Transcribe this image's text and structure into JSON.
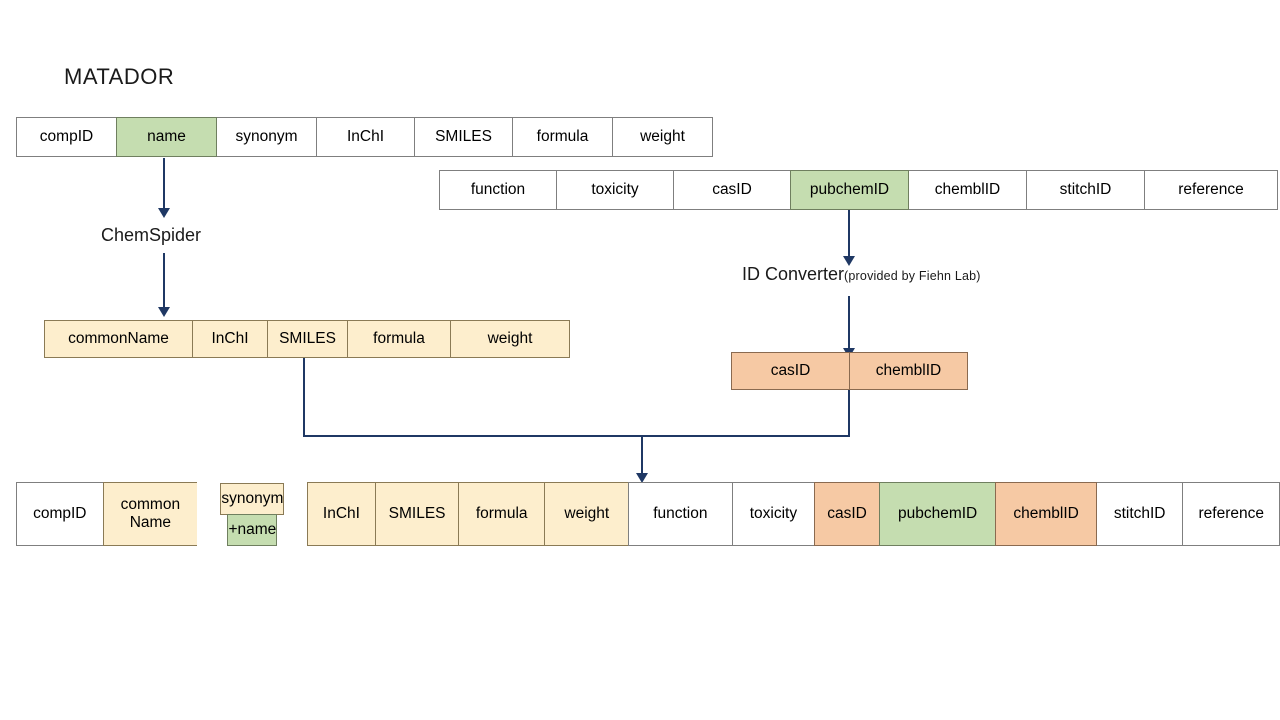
{
  "diagram": {
    "title": "MATADOR",
    "labels": {
      "chemspider": "ChemSpider",
      "id_converter": "ID Converter",
      "id_converter_note": "(provided by Fiehn Lab)"
    },
    "colors": {
      "green": "#c5ddb0",
      "tan": "#fdeecd",
      "orange": "#f6c9a4",
      "arrow": "#1f3864",
      "border": "#7f7f7f"
    },
    "matador_row_1": [
      {
        "label": "compID",
        "fill": "white"
      },
      {
        "label": "name",
        "fill": "green"
      },
      {
        "label": "synonym",
        "fill": "white"
      },
      {
        "label": "InChI",
        "fill": "white"
      },
      {
        "label": "SMILES",
        "fill": "white"
      },
      {
        "label": "formula",
        "fill": "white"
      },
      {
        "label": "weight",
        "fill": "white"
      }
    ],
    "matador_row_2": [
      {
        "label": "function",
        "fill": "white"
      },
      {
        "label": "toxicity",
        "fill": "white"
      },
      {
        "label": "casID",
        "fill": "white"
      },
      {
        "label": "pubchemID",
        "fill": "green"
      },
      {
        "label": "chemblID",
        "fill": "white"
      },
      {
        "label": "stitchID",
        "fill": "white"
      },
      {
        "label": "reference",
        "fill": "white"
      }
    ],
    "chemspider_row": [
      {
        "label": "commonName",
        "fill": "tan"
      },
      {
        "label": "InChI",
        "fill": "tan"
      },
      {
        "label": "SMILES",
        "fill": "tan"
      },
      {
        "label": "formula",
        "fill": "tan"
      },
      {
        "label": "weight",
        "fill": "tan"
      }
    ],
    "converter_row": [
      {
        "label": "casID",
        "fill": "orange"
      },
      {
        "label": "chemblID",
        "fill": "orange"
      }
    ],
    "merged_row": [
      {
        "label": "compID",
        "fill": "white"
      },
      {
        "label": "common\nName",
        "line1": "common",
        "line2": "Name",
        "fill": "tan"
      },
      {
        "label": "synonym",
        "label2": "+name",
        "fill": "split"
      },
      {
        "label": "InChI",
        "fill": "tan"
      },
      {
        "label": "SMILES",
        "fill": "tan"
      },
      {
        "label": "formula",
        "fill": "tan"
      },
      {
        "label": "weight",
        "fill": "tan"
      },
      {
        "label": "function",
        "fill": "white"
      },
      {
        "label": "toxicity",
        "fill": "white"
      },
      {
        "label": "casID",
        "fill": "orange"
      },
      {
        "label": "pubchemID",
        "fill": "green"
      },
      {
        "label": "chemblID",
        "fill": "orange"
      },
      {
        "label": "stitchID",
        "fill": "white"
      },
      {
        "label": "reference",
        "fill": "white"
      }
    ]
  }
}
